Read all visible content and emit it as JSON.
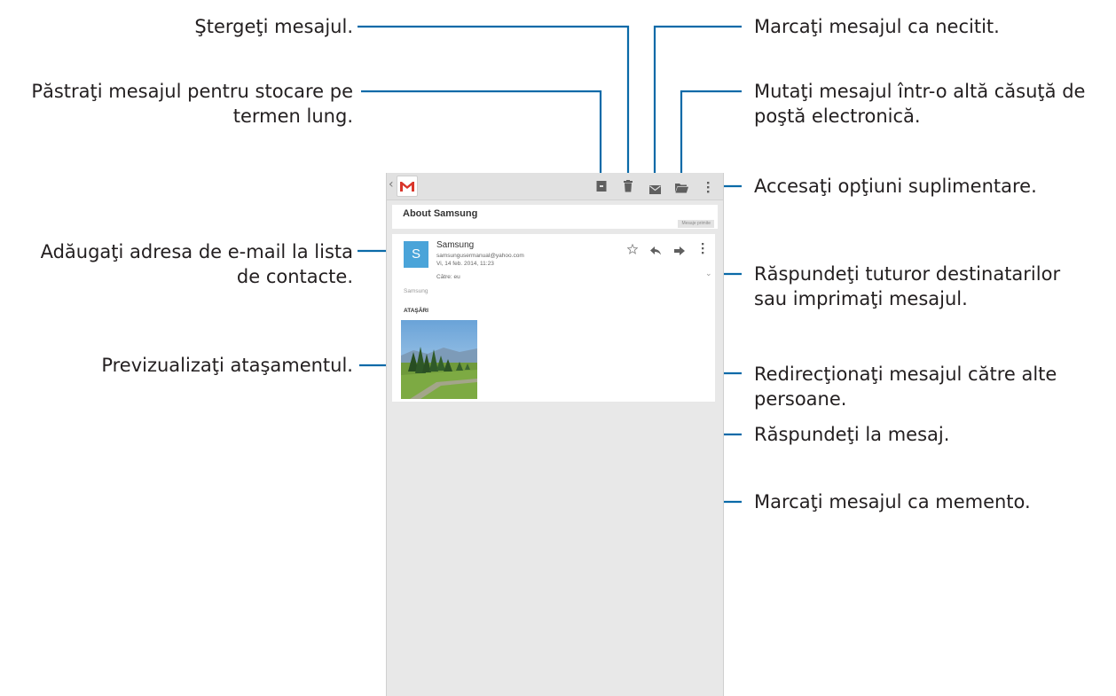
{
  "callouts": {
    "delete": "Ştergeţi mesajul.",
    "archive": [
      "Păstraţi mesajul pentru stocare pe",
      "termen lung."
    ],
    "add_contact": [
      "Adăugaţi adresa de e-mail la lista",
      "de contacte."
    ],
    "preview_attachment": "Previzualizaţi ataşamentul.",
    "mark_unread": "Marcaţi mesajul ca necitit.",
    "move": [
      "Mutaţi mesajul într-o altă căsuţă de",
      "poştă electronică."
    ],
    "more_options": "Accesaţi opţiuni suplimentare.",
    "reply_all_print": [
      "Răspundeţi tuturor destinatarilor",
      "sau imprimaţi mesajul."
    ],
    "forward": [
      "Redirecţionaţi mesajul către alte",
      "persoane."
    ],
    "reply": "Răspundeţi la mesaj.",
    "star": "Marcaţi mesajul ca memento."
  },
  "email": {
    "subject": "About Samsung",
    "label_chip": "Mesaje primite",
    "avatar_letter": "S",
    "sender_name": "Samsung",
    "sender_email": "samsungusermanual@yahoo.com",
    "date": "Vi, 14 feb. 2014, 11:23",
    "to": "Către: eu",
    "body": "Samsung",
    "attachments_heading": "ATAŞĂRI"
  },
  "icons": {
    "back": "chevron-left-icon",
    "app": "gmail-icon",
    "archive": "archive-icon",
    "delete": "trash-icon",
    "unread": "envelope-icon",
    "move": "folder-icon",
    "more": "more-vertical-icon",
    "star": "star-icon",
    "reply": "reply-icon",
    "forward": "forward-icon",
    "expand": "chevron-down-icon"
  },
  "colors": {
    "leader_line": "#0a6aa8",
    "avatar": "#4aa4d9",
    "gmail_red": "#d9352a",
    "icon_gray": "#5f5f5f"
  }
}
